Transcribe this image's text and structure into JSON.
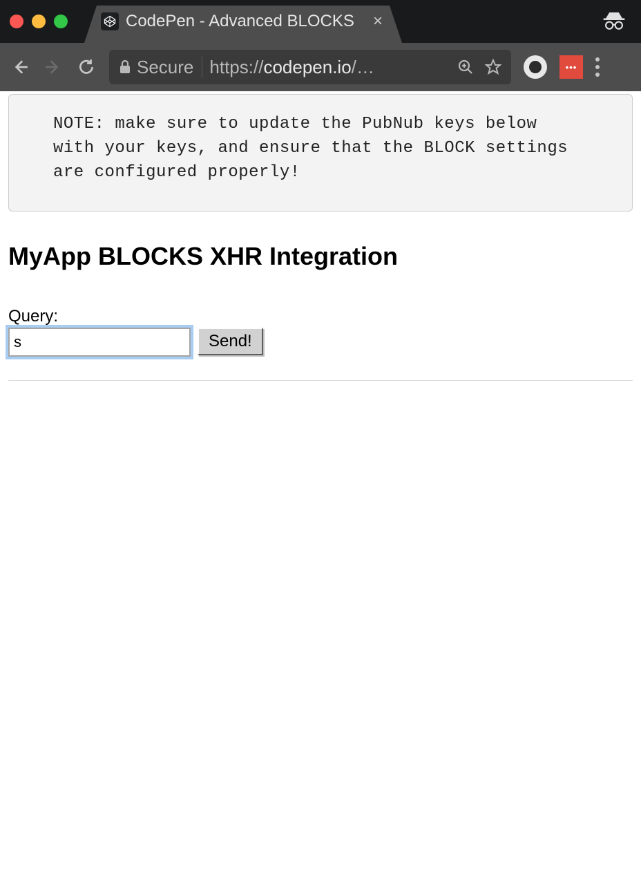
{
  "browser": {
    "tab_title": "CodePen - Advanced BLOCKS",
    "secure_label": "Secure",
    "url_scheme": "https://",
    "url_host": "codepen.io",
    "url_path": "/…"
  },
  "note": {
    "text": "NOTE: make sure to update the PubNub keys below with your keys, and ensure that the BLOCK settings are configured properly!"
  },
  "page": {
    "heading": "MyApp BLOCKS XHR Integration",
    "query_label": "Query:",
    "query_value": "s",
    "send_label": "Send!"
  },
  "ext": {
    "red_label": "•••"
  }
}
